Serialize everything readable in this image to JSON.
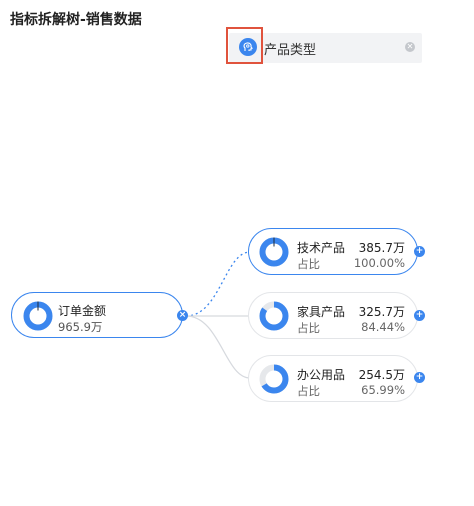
{
  "title": "指标拆解树-销售数据",
  "dimension": {
    "label": "产品类型",
    "icon": "brain-ai-icon",
    "clear_icon": "close-icon",
    "accent": "#3b86ee",
    "highlight": "#e0533d"
  },
  "root": {
    "name": "订单金额",
    "value": "965.9万",
    "ratio": 1.0,
    "toggle_symbol": "×"
  },
  "children": [
    {
      "name": "技术产品",
      "value": "385.7万",
      "ratio_label": "占比",
      "ratio_value": "100.00%",
      "ratio": 1.0,
      "toggle_symbol": "+"
    },
    {
      "name": "家具产品",
      "value": "325.7万",
      "ratio_label": "占比",
      "ratio_value": "84.44%",
      "ratio": 0.8444,
      "toggle_symbol": "+"
    },
    {
      "name": "办公用品",
      "value": "254.5万",
      "ratio_label": "占比",
      "ratio_value": "65.99%",
      "ratio": 0.6599,
      "toggle_symbol": "+"
    }
  ]
}
